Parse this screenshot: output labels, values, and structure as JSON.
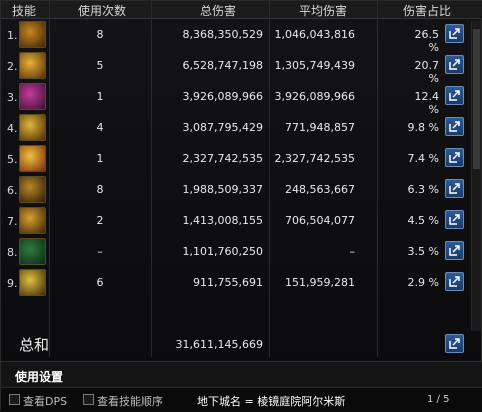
{
  "header": {
    "skill": "技能",
    "uses": "使用次数",
    "total": "总伤害",
    "avg": "平均伤害",
    "share": "伤害占比"
  },
  "rows": [
    {
      "n": "1.",
      "uses": "8",
      "total": "8,368,350,529",
      "avg": "1,046,043,816",
      "pct": "26.5 %",
      "icon": "swirl-slash-icon",
      "c1": "#c8861f",
      "c2": "#3a2408"
    },
    {
      "n": "2.",
      "uses": "5",
      "total": "6,528,747,198",
      "avg": "1,305,749,439",
      "pct": "20.7 %",
      "icon": "blade-burst-icon",
      "c1": "#e2b23a",
      "c2": "#5a2b06"
    },
    {
      "n": "3.",
      "uses": "1",
      "total": "3,926,089,966",
      "avg": "3,926,089,966",
      "pct": "12.4 %",
      "icon": "fire-aura-icon",
      "c1": "#c43a9c",
      "c2": "#3a1030"
    },
    {
      "n": "4.",
      "uses": "4",
      "total": "3,087,795,429",
      "avg": "771,948,857",
      "pct": "9.8 %",
      "icon": "crescent-wave-icon",
      "c1": "#e0b63c",
      "c2": "#4a2a06"
    },
    {
      "n": "5.",
      "uses": "1",
      "total": "2,327,742,535",
      "avg": "2,327,742,535",
      "pct": "7.4 %",
      "icon": "explosion-icon",
      "c1": "#f0c040",
      "c2": "#7a2a0a"
    },
    {
      "n": "6.",
      "uses": "8",
      "total": "1,988,509,337",
      "avg": "248,563,667",
      "pct": "6.3 %",
      "icon": "dash-strike-icon",
      "c1": "#b8862a",
      "c2": "#2a1a06"
    },
    {
      "n": "7.",
      "uses": "2",
      "total": "1,413,008,155",
      "avg": "706,504,077",
      "pct": "4.5 %",
      "icon": "star-burst-icon",
      "c1": "#d8a030",
      "c2": "#3a2206"
    },
    {
      "n": "8.",
      "uses": "–",
      "total": "1,101,760,250",
      "avg": "–",
      "pct": "3.5 %",
      "icon": "green-rune-icon",
      "c1": "#2e7a3e",
      "c2": "#0a2a12"
    },
    {
      "n": "9.",
      "uses": "6",
      "total": "911,755,691",
      "avg": "151,959,281",
      "pct": "2.9 %",
      "icon": "lightning-slash-icon",
      "c1": "#e0c040",
      "c2": "#3a2a06"
    }
  ],
  "summary": {
    "label": "总和",
    "total": "31,611,145,669"
  },
  "settings_label": "使用设置",
  "footer": {
    "view_dps": "查看DPS",
    "view_order": "查看技能顺序",
    "dungeon": "地下城名 = 棱镜庭院阿尔米斯",
    "pager": "1 / 5"
  },
  "share_icon": "share-export-icon"
}
